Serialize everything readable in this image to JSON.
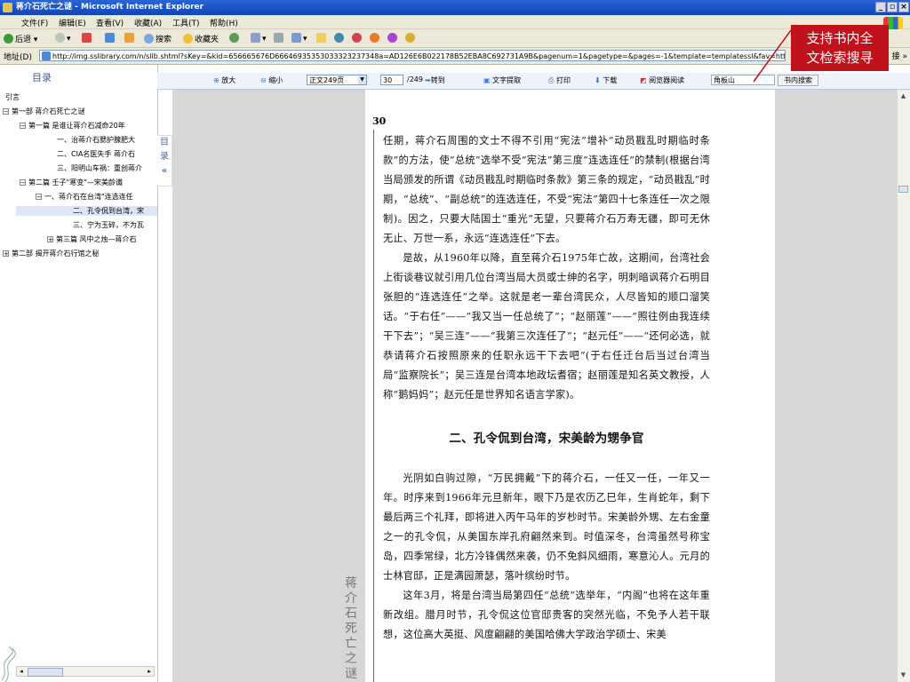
{
  "window": {
    "title": "蒋介石死亡之谜 - Microsoft Internet Explorer",
    "min": "_",
    "max": "▫",
    "close": "×"
  },
  "menu": [
    "文件(F)",
    "编辑(E)",
    "查看(V)",
    "收藏(A)",
    "工具(T)",
    "帮助(H)"
  ],
  "toolbar": {
    "back": "后退",
    "search": "搜索",
    "favorites": "收藏夹"
  },
  "address": {
    "label": "地址(D)",
    "url": "http://img.sslibrary.com/n/slib.shtml?sKey=&kid=656665676D66646935353033323237348a=AD126E6B022178B52EBA8C692731A9B&pagenum=1&pagetype=&pages=-1&template=templatessl&fav=http%3A%2",
    "more": "接 »"
  },
  "sidebar": {
    "heading": "目录",
    "items": [
      "引言",
      "第一部 蒋介石死亡之谜",
      "第一篇 是谁让蒋介石减命20年",
      "一、治蒋介石腮护腺肥大",
      "二、CIA名医失手 蒋介石",
      "三、阳明山车祸：重创蒋介",
      "第二篇 壬子\"寒变\"—宋美龄谶",
      "一、蒋介石在台湾\"连选连任",
      "二、孔令侃到台湾，宋",
      "三、宁为玉碎，不为瓦",
      "第三篇 风中之烛—蒋介石",
      "第二部 揭开蒋介石行馆之秘"
    ],
    "toc_tab": [
      "目",
      "录",
      "«"
    ]
  },
  "reader": {
    "zoom_in": "放大",
    "zoom_out": "缩小",
    "page_select": "正文249页",
    "page_input": "30",
    "page_total": "/249",
    "goto": "转到",
    "text_extract": "文字提取",
    "print": "打印",
    "download": "下载",
    "reader_view": "阅览器阅读",
    "search_value": "角板山",
    "search_button": "书内搜索"
  },
  "page": {
    "number": "30",
    "spine": [
      "蒋",
      "介",
      "石",
      "死",
      "亡",
      "之",
      "谜"
    ],
    "p1": "任期，蒋介石周围的文士不得不引用“宪法”增补“动员戡乱时期临时条款”的方法，使“总统”选举不受“宪法”第三度“连选连任”的禁制(根据台湾当局颁发的所谓《动员戡乱时期临时条款》第三条的规定，“动员戡乱”时期，“总统”、“副总统”的连选连任，不受“宪法”第四十七条连任一次之限制)。因之，只要大陆国土“重光”无望，只要蒋介石万寿无疆，即可无休无止、万世一系，永远“连选连任”下去。",
    "p2": "是故，从1960年以降，直至蒋介石1975年亡故，这期间，台湾社会上街谈巷议就引用几位台湾当局大员或士绅的名字，明刺暗讽蒋介石明目张胆的“连选连任”之举。这就是老一辈台湾民众，人尽皆知的顺口溜笑话。“于右任”——“我又当一任总统了”；“赵丽莲”——“照往例由我连续干下去”；“吴三连”——“我第三次连任了”；“赵元任”——“还何必选，就恭请蒋介石按照原来的任职永远干下去吧”(于右任迁台后当过台湾当局“监察院长”；吴三连是台湾本地政坛耆宿；赵丽莲是知名英文教授，人称“鹅妈妈”；赵元任是世界知名语言学家)。",
    "heading": "二、孔令侃到台湾，宋美龄为甥争官",
    "p3": "光阴如白驹过隙，“万民拥戴”下的蒋介石，一任又一任，一年又一年。时序来到1966年元旦新年，眼下乃是农历乙巳年，生肖蛇年，剩下最后两三个礼拜，即将进入丙午马年的岁杪时节。宋美龄外甥、左右金童之一的孔令侃，从美国东岸孔府翩然来到。时值深冬，台湾虽然号称宝岛，四季常绿，北方冷锋偶然来袭，仍不免斜风细雨，寒意沁人。元月的士林官邸，正是满园萧瑟，落叶缤纷时节。",
    "p4": "这年3月，将是台湾当局第四任“总统”选举年，“内阁”也将在这年重新改组。腊月时节，孔令侃这位官邸贵客的突然光临，不免予人若干联想，这位高大英挺、风度翩翩的美国哈佛大学政治学硕士、宋美"
  },
  "callout": {
    "line1": "支持书内全",
    "line2": "文检索搜寻",
    "color": "#c0121b"
  }
}
